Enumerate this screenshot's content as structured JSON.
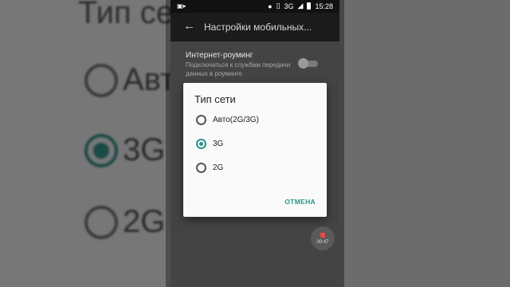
{
  "status_bar": {
    "left_icon": "video-camera-icon",
    "network_type": "3G",
    "time": "15:28"
  },
  "app_bar": {
    "title": "Настройки мобильных..."
  },
  "settings": {
    "roaming_title": "Интернет-роуминг",
    "roaming_subtitle": "Подключаться к службам передачи данных в роуминге",
    "roaming_enabled": false
  },
  "dialog": {
    "title": "Тип сети",
    "options": [
      {
        "label": "Авто(2G/3G)",
        "selected": false
      },
      {
        "label": "3G",
        "selected": true
      },
      {
        "label": "2G",
        "selected": false
      }
    ],
    "cancel_label": "ОТМЕНА"
  },
  "recorder": {
    "time": "00:47"
  },
  "background_zoom": {
    "title": "Тип сет",
    "options": [
      "Авто",
      "3G",
      "2G"
    ]
  },
  "colors": {
    "accent": "#26968b"
  }
}
